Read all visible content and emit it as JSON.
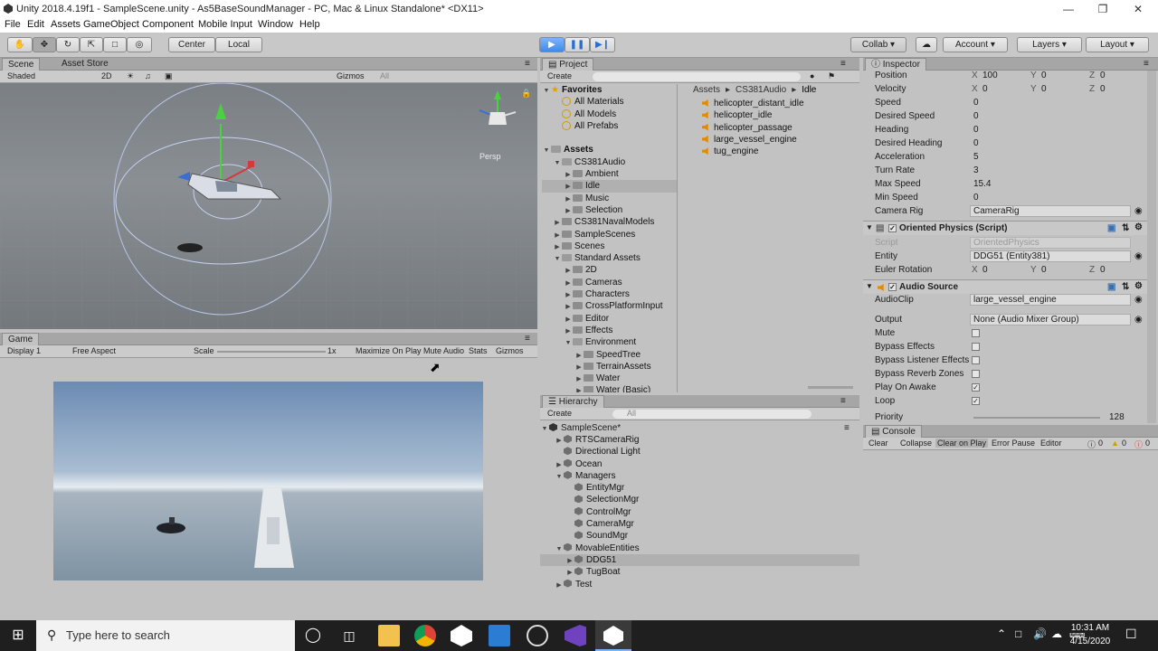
{
  "window": {
    "title": "Unity 2018.4.19f1 - SampleScene.unity - As5BaseSoundManager - PC, Mac & Linux Standalone* <DX11>"
  },
  "menu": [
    "File",
    "Edit",
    "Assets",
    "GameObject",
    "Component",
    "Mobile Input",
    "Window",
    "Help"
  ],
  "toolbar": {
    "center_label": "Center",
    "local_label": "Local",
    "collab_label": "Collab",
    "account_label": "Account",
    "layers_label": "Layers",
    "layout_label": "Layout"
  },
  "scene": {
    "tab_scene": "Scene",
    "tab_asset_store": "Asset Store",
    "shading": "Shaded",
    "mode_2d": "2D",
    "gizmos": "Gizmos",
    "search": "All",
    "persp": "Persp"
  },
  "game": {
    "tab": "Game",
    "display": "Display 1",
    "aspect": "Free Aspect",
    "scale_label": "Scale",
    "scale_value": "1x",
    "maximize": "Maximize On Play",
    "mute": "Mute Audio",
    "stats": "Stats",
    "gizmos": "Gizmos"
  },
  "project": {
    "tab": "Project",
    "create": "Create",
    "breadcrumb": [
      "Assets",
      "CS381Audio",
      "Idle"
    ],
    "favorites_label": "Favorites",
    "favorites": [
      "All Materials",
      "All Models",
      "All Prefabs"
    ],
    "assets_label": "Assets",
    "tree": [
      {
        "label": "CS381Audio",
        "depth": 1,
        "open": true
      },
      {
        "label": "Ambient",
        "depth": 2
      },
      {
        "label": "Idle",
        "depth": 2,
        "selected": true
      },
      {
        "label": "Music",
        "depth": 2
      },
      {
        "label": "Selection",
        "depth": 2
      },
      {
        "label": "CS381NavalModels",
        "depth": 1
      },
      {
        "label": "SampleScenes",
        "depth": 1
      },
      {
        "label": "Scenes",
        "depth": 1
      },
      {
        "label": "Standard Assets",
        "depth": 1,
        "open": true
      },
      {
        "label": "2D",
        "depth": 2
      },
      {
        "label": "Cameras",
        "depth": 2
      },
      {
        "label": "Characters",
        "depth": 2
      },
      {
        "label": "CrossPlatformInput",
        "depth": 2
      },
      {
        "label": "Editor",
        "depth": 2
      },
      {
        "label": "Effects",
        "depth": 2
      },
      {
        "label": "Environment",
        "depth": 2,
        "open": true
      },
      {
        "label": "SpeedTree",
        "depth": 3
      },
      {
        "label": "TerrainAssets",
        "depth": 3
      },
      {
        "label": "Water",
        "depth": 3
      },
      {
        "label": "Water (Basic)",
        "depth": 3
      }
    ],
    "files": [
      "helicopter_distant_idle",
      "helicopter_idle",
      "helicopter_passage",
      "large_vessel_engine",
      "tug_engine"
    ]
  },
  "hierarchy": {
    "tab": "Hierarchy",
    "create": "Create",
    "search": "All",
    "scene": "SampleScene*",
    "items": [
      {
        "label": "RTSCameraRig",
        "depth": 1,
        "arrow": true
      },
      {
        "label": "Directional Light",
        "depth": 1
      },
      {
        "label": "Ocean",
        "depth": 1,
        "arrow": true
      },
      {
        "label": "Managers",
        "depth": 1,
        "open": true
      },
      {
        "label": "EntityMgr",
        "depth": 2
      },
      {
        "label": "SelectionMgr",
        "depth": 2
      },
      {
        "label": "ControlMgr",
        "depth": 2
      },
      {
        "label": "CameraMgr",
        "depth": 2
      },
      {
        "label": "SoundMgr",
        "depth": 2
      },
      {
        "label": "MovableEntities",
        "depth": 1,
        "open": true
      },
      {
        "label": "DDG51",
        "depth": 2,
        "arrow": true,
        "selected": true
      },
      {
        "label": "TugBoat",
        "depth": 2,
        "arrow": true
      },
      {
        "label": "Test",
        "depth": 1,
        "arrow": true
      }
    ]
  },
  "inspector": {
    "tab": "Inspector",
    "position": {
      "label": "Position",
      "x": "100",
      "y": "0",
      "z": "0"
    },
    "velocity": {
      "label": "Velocity",
      "x": "0",
      "y": "0",
      "z": "0"
    },
    "fields": [
      {
        "label": "Speed",
        "value": "0"
      },
      {
        "label": "Desired Speed",
        "value": "0"
      },
      {
        "label": "Heading",
        "value": "0"
      },
      {
        "label": "Desired Heading",
        "value": "0"
      },
      {
        "label": "Acceleration",
        "value": "5"
      },
      {
        "label": "Turn Rate",
        "value": "3"
      },
      {
        "label": "Max Speed",
        "value": "15.4"
      },
      {
        "label": "Min Speed",
        "value": "0"
      }
    ],
    "camera_rig": {
      "label": "Camera Rig",
      "value": "CameraRig"
    },
    "oriented_physics": {
      "title": "Oriented Physics (Script)",
      "script_label": "Script",
      "script_value": "OrientedPhysics",
      "entity_label": "Entity",
      "entity_value": "DDG51 (Entity381)",
      "euler_label": "Euler Rotation",
      "x": "0",
      "y": "0",
      "z": "0"
    },
    "audio_source": {
      "title": "Audio Source",
      "clip_label": "AudioClip",
      "clip_value": "large_vessel_engine",
      "output_label": "Output",
      "output_value": "None (Audio Mixer Group)",
      "flags": [
        {
          "label": "Mute",
          "checked": false
        },
        {
          "label": "Bypass Effects",
          "checked": false
        },
        {
          "label": "Bypass Listener Effects",
          "checked": false
        },
        {
          "label": "Bypass Reverb Zones",
          "checked": false
        },
        {
          "label": "Play On Awake",
          "checked": true
        },
        {
          "label": "Loop",
          "checked": true
        }
      ],
      "priority_label": "Priority",
      "priority_value": "128"
    }
  },
  "console": {
    "tab": "Console",
    "clear": "Clear",
    "collapse": "Collapse",
    "clear_on_play": "Clear on Play",
    "error_pause": "Error Pause",
    "editor": "Editor",
    "count_info": "0",
    "count_warn": "0",
    "count_error": "0"
  },
  "taskbar": {
    "search_placeholder": "Type here to search",
    "time": "10:31 AM",
    "date": "4/15/2020"
  },
  "axis": {
    "x": "X",
    "y": "Y",
    "z": "Z"
  }
}
